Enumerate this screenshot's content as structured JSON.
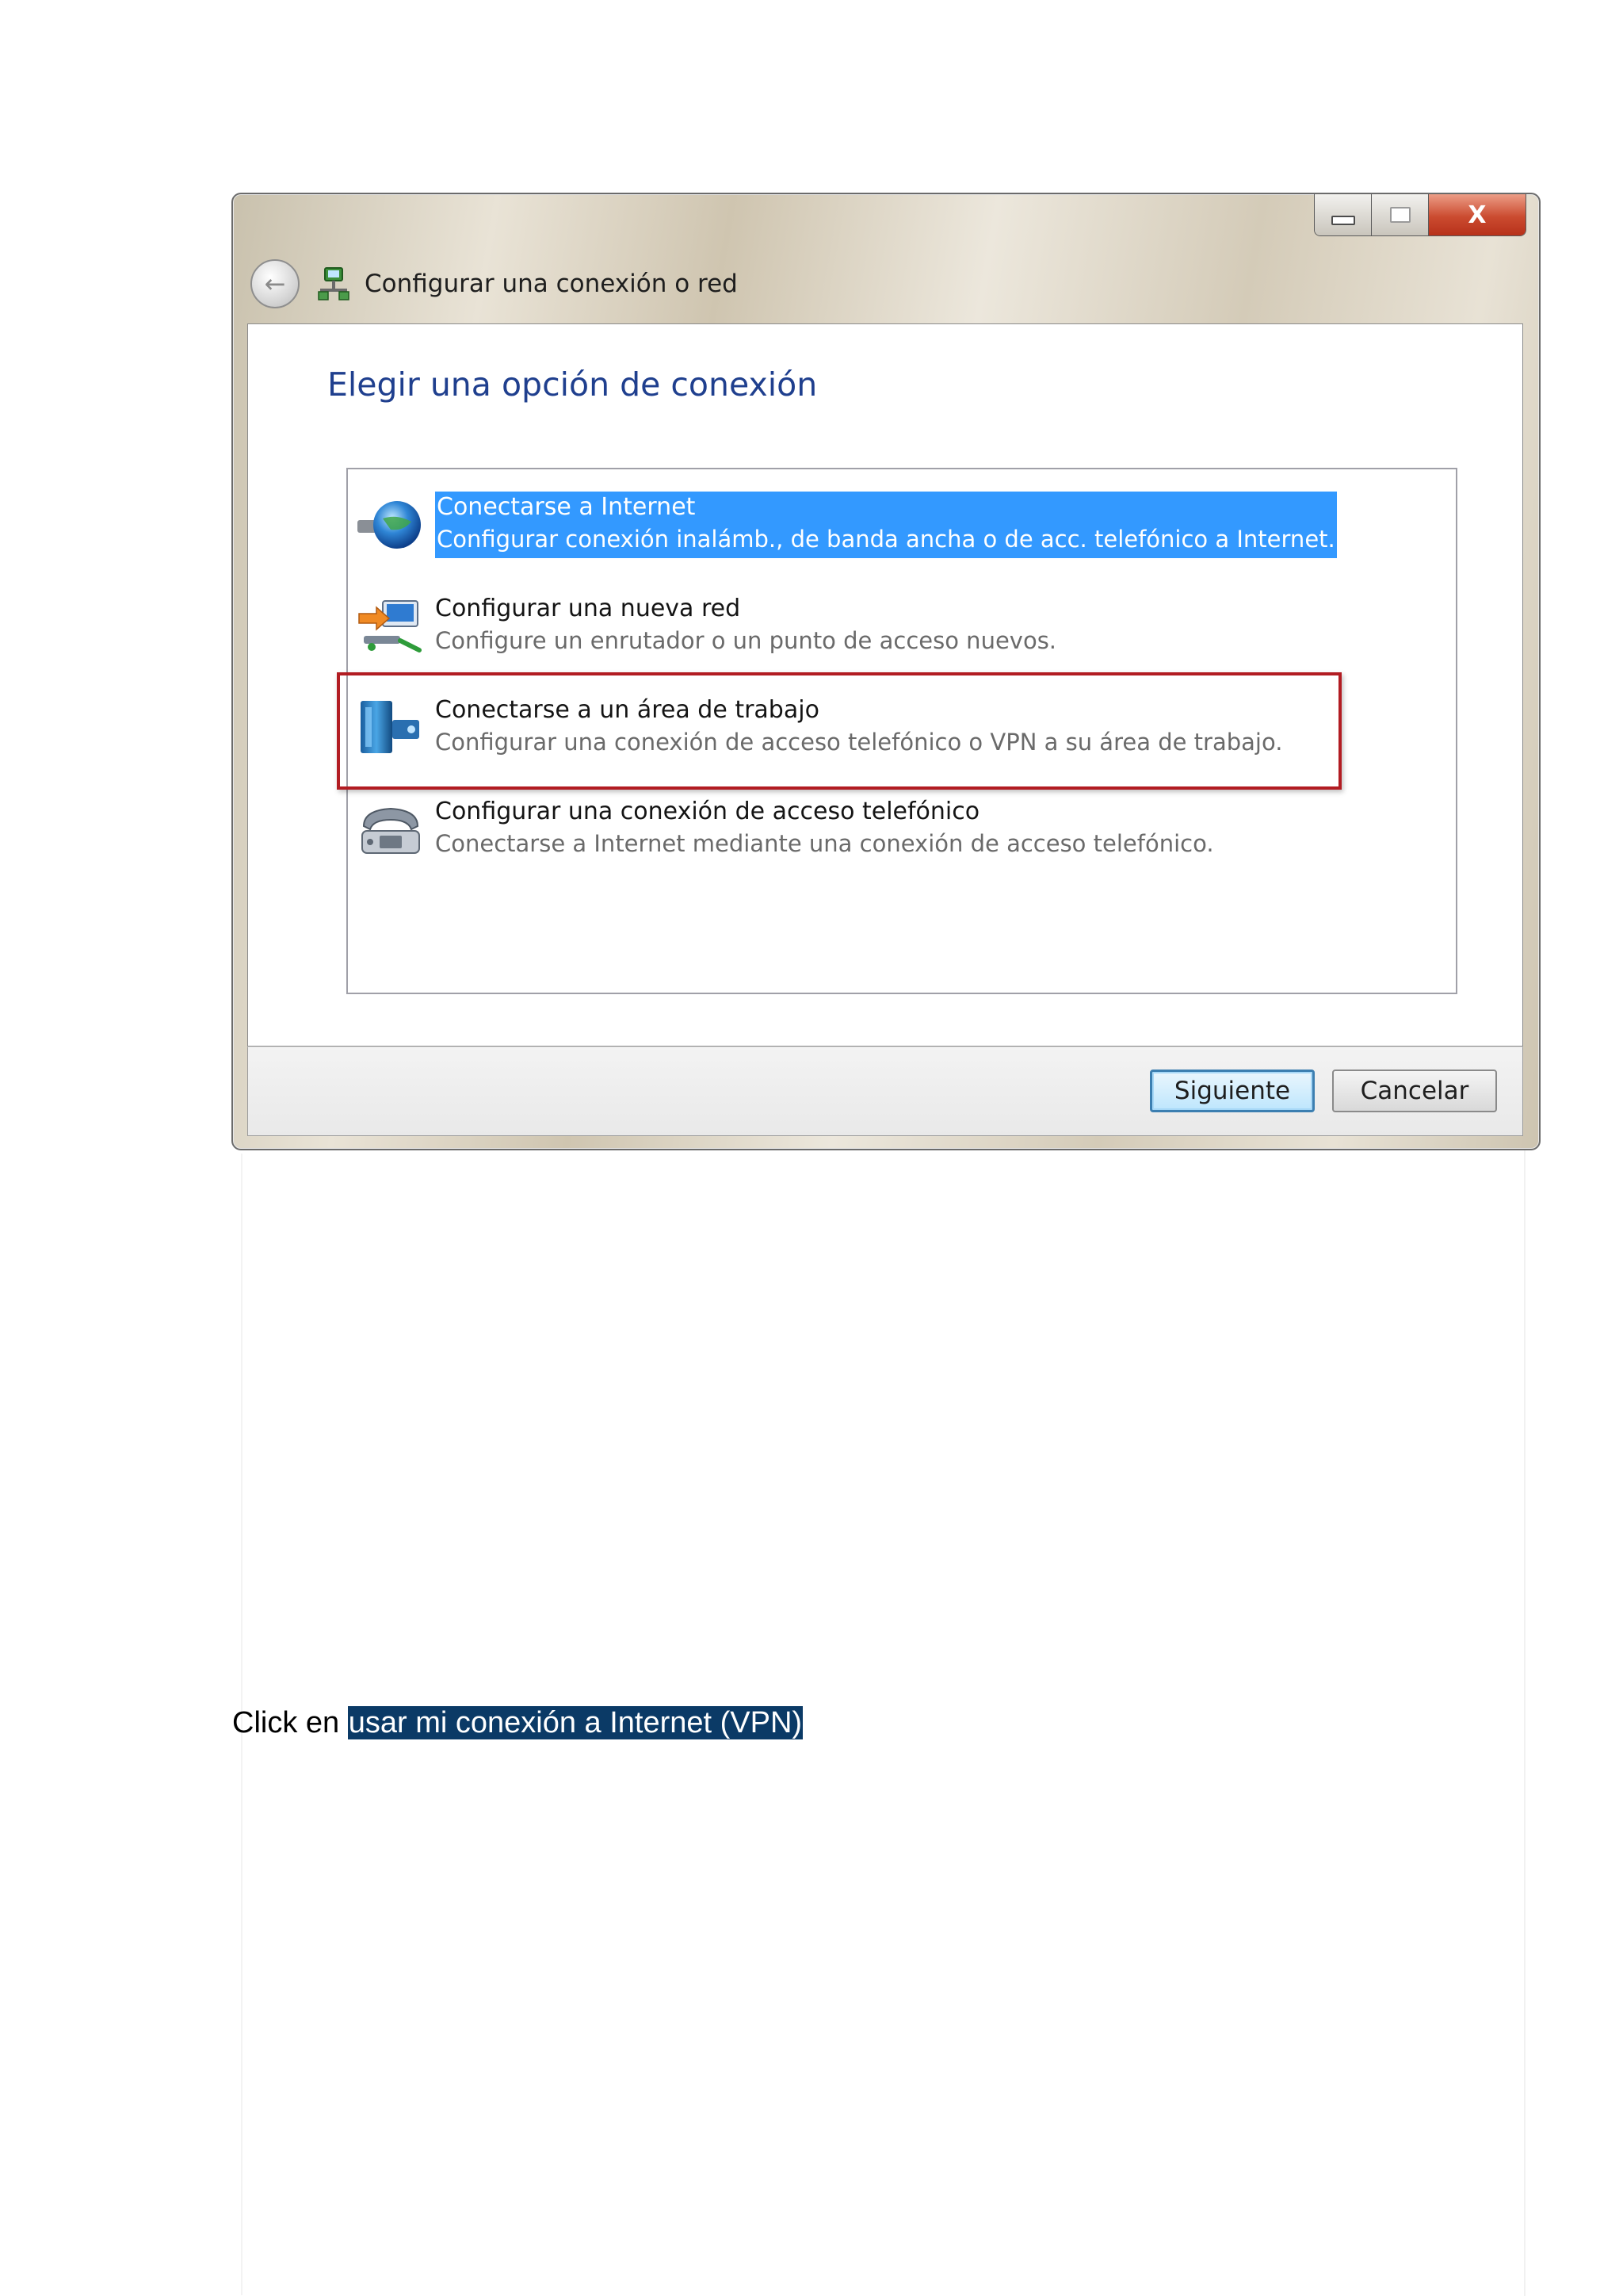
{
  "window": {
    "title": "Configurar una conexión o red",
    "close_glyph": "X"
  },
  "heading": "Elegir una opción de conexión",
  "options": [
    {
      "title": "Conectarse a Internet",
      "description": "Configurar conexión inalámb., de banda ancha o de acc. telefónico a Internet.",
      "icon": "globe-network-icon",
      "selected": true
    },
    {
      "title": "Configurar una nueva red",
      "description": "Configure un enrutador o un punto de acceso nuevos.",
      "icon": "new-network-icon",
      "selected": false
    },
    {
      "title": "Conectarse a un área de trabajo",
      "description": "Configurar una conexión de acceso telefónico o VPN a su área de trabajo.",
      "icon": "workplace-building-icon",
      "selected": false,
      "highlighted": true
    },
    {
      "title": "Configurar una conexión de acceso telefónico",
      "description": "Conectarse a Internet mediante una conexión de acceso telefónico.",
      "icon": "telephone-modem-icon",
      "selected": false
    }
  ],
  "buttons": {
    "next": "Siguiente",
    "cancel": "Cancelar"
  },
  "instruction": {
    "prefix": "Click en ",
    "highlighted": "usar mi conexión a Internet (VPN)"
  },
  "colors": {
    "selection": "#3399ff",
    "heading": "#1f3f8e",
    "annotation_box": "#b21c22",
    "text_highlight": "#0b3a66"
  }
}
